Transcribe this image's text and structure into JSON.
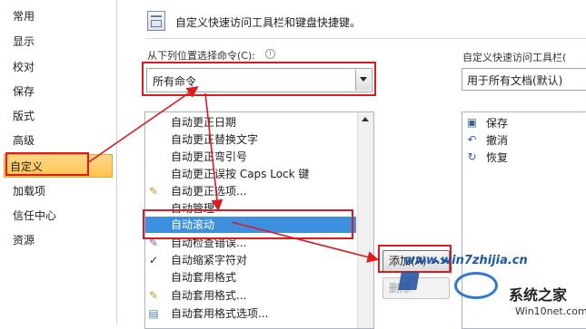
{
  "sidebar": {
    "items": [
      {
        "label": "常用"
      },
      {
        "label": "显示"
      },
      {
        "label": "校对"
      },
      {
        "label": "保存"
      },
      {
        "label": "版式"
      },
      {
        "label": "高级"
      },
      {
        "label": "自定义",
        "selected": true
      },
      {
        "label": "加载项"
      },
      {
        "label": "信任中心"
      },
      {
        "label": "资源"
      }
    ]
  },
  "header": {
    "title": "自定义快速访问工具栏和键盘快捷键。"
  },
  "left_panel": {
    "choose_label": "从下列位置选择命令(C):",
    "choose_value": "所有命令",
    "commands": [
      {
        "icon": "",
        "label": "自动更正日期"
      },
      {
        "icon": "",
        "label": "自动更正替换文字"
      },
      {
        "icon": "",
        "label": "自动更正弯引号"
      },
      {
        "icon": "",
        "label": "自动更正误按 Caps Lock 键"
      },
      {
        "icon": "autocorrect-icon",
        "label": "自动更正选项..."
      },
      {
        "icon": "",
        "label": "自动管理"
      },
      {
        "icon": "",
        "label": "自动滚动",
        "selected": true
      },
      {
        "icon": "check-errors-icon",
        "label": "自动检查错误..."
      },
      {
        "icon": "checkmark-icon",
        "label": "自动缩紧字符对"
      },
      {
        "icon": "",
        "label": "自动套用格式"
      },
      {
        "icon": "autoformat-icon",
        "label": "自动套用格式..."
      },
      {
        "icon": "autoformat-options-icon",
        "label": "自动套用格式选项..."
      }
    ]
  },
  "right_panel": {
    "customize_label": "自定义快速访问工具栏(",
    "customize_value": "用于所有文档(默认)",
    "items": [
      {
        "icon": "save-icon",
        "label": "保存"
      },
      {
        "icon": "undo-icon",
        "label": "撤消"
      },
      {
        "icon": "redo-icon",
        "label": "恢复"
      }
    ]
  },
  "buttons": {
    "add": "添加(A) >>",
    "remove": "删除"
  },
  "watermark": {
    "site": "www.win7zhijia.cn",
    "brand": "系统之家",
    "url": "Win10net.com"
  },
  "colors": {
    "accent_red": "#e0191e",
    "selection_blue": "#3d8fe0",
    "nav_selected": "#ffc44f"
  }
}
